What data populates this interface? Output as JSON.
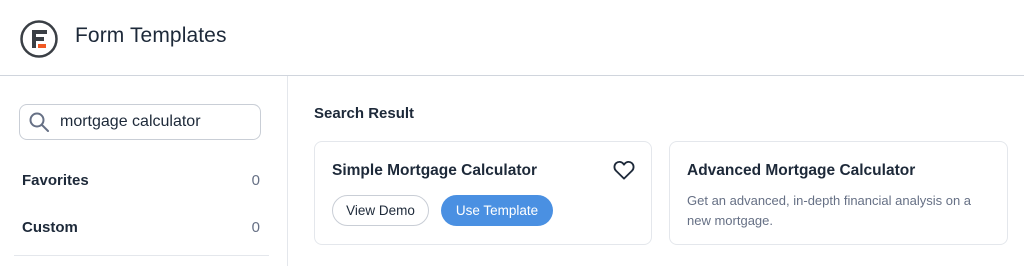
{
  "header": {
    "title": "Form Templates",
    "logo_icon": "formidable-logo-icon"
  },
  "sidebar": {
    "search": {
      "value": "mortgage calculator",
      "icon": "search-icon"
    },
    "items": [
      {
        "label": "Favorites",
        "count": "0"
      },
      {
        "label": "Custom",
        "count": "0"
      }
    ]
  },
  "main": {
    "section_title": "Search Result",
    "cards": [
      {
        "title": "Simple Mortgage Calculator",
        "view_demo_label": "View Demo",
        "use_template_label": "Use Template"
      },
      {
        "title": "Advanced Mortgage Calculator",
        "description": "Get an advanced, in-depth financial analysis on a new mortgage."
      }
    ]
  },
  "colors": {
    "accent": "#4a90e2",
    "logo_orange": "#f15a24",
    "text_dark": "#1d2939",
    "text_muted": "#667085",
    "border": "#e4e7ec"
  }
}
